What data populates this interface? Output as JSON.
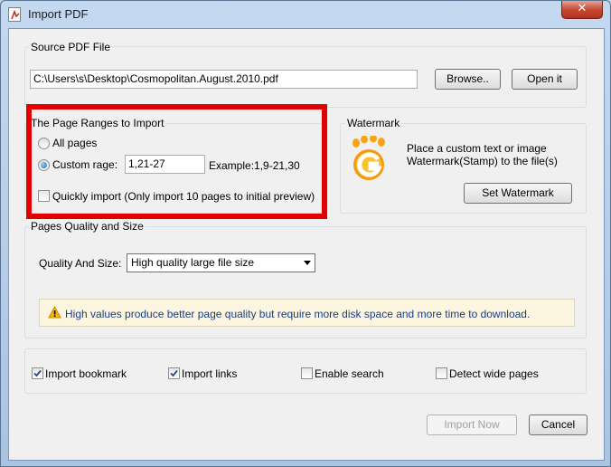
{
  "window": {
    "title": "Import PDF",
    "close_glyph": "✕"
  },
  "source": {
    "group_label": "Source PDF File",
    "path_value": "C:\\Users\\s\\Desktop\\Cosmopolitan.August.2010.pdf",
    "browse_label": "Browse..",
    "open_label": "Open it"
  },
  "ranges": {
    "group_label": "The Page Ranges to Import",
    "all_pages_label": "All pages",
    "custom_label": "Custom rage:",
    "custom_value": "1,21-27",
    "example_text": "Example:1,9-21,30",
    "quick_label": "Quickly import (Only import 10 pages to  initial  preview)",
    "selected": "custom",
    "quick_checked": false
  },
  "watermark": {
    "group_label": "Watermark",
    "desc_line1": "Place a custom text or image",
    "desc_line2": "Watermark(Stamp) to the file(s)",
    "button_label": "Set Watermark",
    "icon": "foot-g-logo-icon"
  },
  "quality": {
    "group_label": "Pages Quality and Size",
    "field_label": "Quality And Size:",
    "selected_option": "High quality large file size",
    "info_text": "High values produce better page quality but require more disk space and more time to download.",
    "info_icon": "warning-icon"
  },
  "options": {
    "import_bookmark": {
      "label": "Import bookmark",
      "checked": true
    },
    "import_links": {
      "label": "Import links",
      "checked": true
    },
    "enable_search": {
      "label": "Enable search",
      "checked": false
    },
    "detect_wide": {
      "label": "Detect wide pages",
      "checked": false
    }
  },
  "footer": {
    "import_now_label": "Import Now",
    "cancel_label": "Cancel"
  },
  "colors": {
    "highlight_box": "#e40000",
    "info_bg": "#fcf5e0",
    "info_text": "#1a3e85"
  }
}
